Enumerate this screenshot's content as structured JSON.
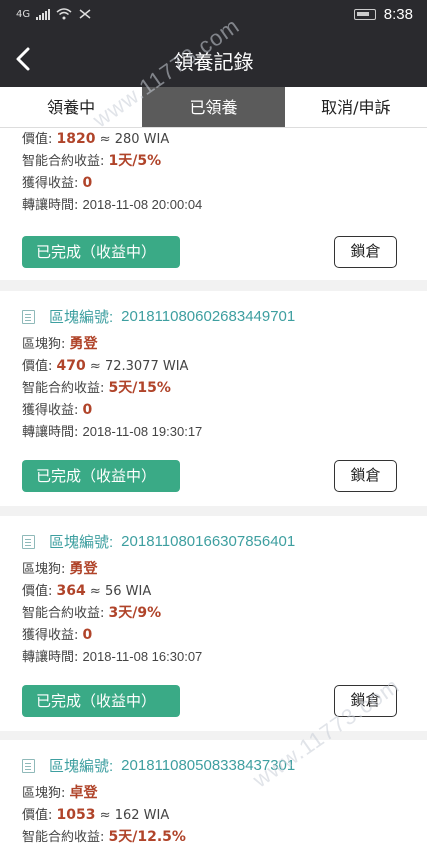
{
  "status_bar": {
    "network": "4G",
    "time": "8:38"
  },
  "nav": {
    "title": "領養記錄"
  },
  "tabs": [
    {
      "label": "領養中",
      "active": false
    },
    {
      "label": "已領養",
      "active": true
    },
    {
      "label": "取消/申訴",
      "active": false
    }
  ],
  "labels": {
    "block_id": "區塊編號:",
    "dog": "區塊狗:",
    "value": "價值:",
    "contract": "智能合約收益:",
    "earned": "獲得收益:",
    "transfer_time": "轉讓時間:",
    "approx": "≈",
    "wia_unit": "WIA"
  },
  "cards": [
    {
      "value": "1820",
      "wia": "280",
      "contract": "1天/5%",
      "earned": "0",
      "time": "2018-11-08 20:00:04",
      "status": "已完成（收益中）",
      "lock": "鎖倉"
    },
    {
      "block_id": "201811080602683449701",
      "dog": "勇登",
      "value": "470",
      "wia": "72.3077",
      "contract": "5天/15%",
      "earned": "0",
      "time": "2018-11-08 19:30:17",
      "status": "已完成（收益中）",
      "lock": "鎖倉"
    },
    {
      "block_id": "201811080166307856401",
      "dog": "勇登",
      "value": "364",
      "wia": "56",
      "contract": "3天/9%",
      "earned": "0",
      "time": "2018-11-08 16:30:07",
      "status": "已完成（收益中）",
      "lock": "鎖倉"
    },
    {
      "block_id": "201811080508338437301",
      "dog": "卓登",
      "value": "1053",
      "wia": "162",
      "contract": "5天/12.5%"
    }
  ],
  "watermark": "www.11773.com",
  "colors": {
    "header_bg": "#2a2a2e",
    "accent_green": "#3aaa86",
    "value_red": "#b0442a",
    "block_id_teal": "#3e9fa0"
  }
}
